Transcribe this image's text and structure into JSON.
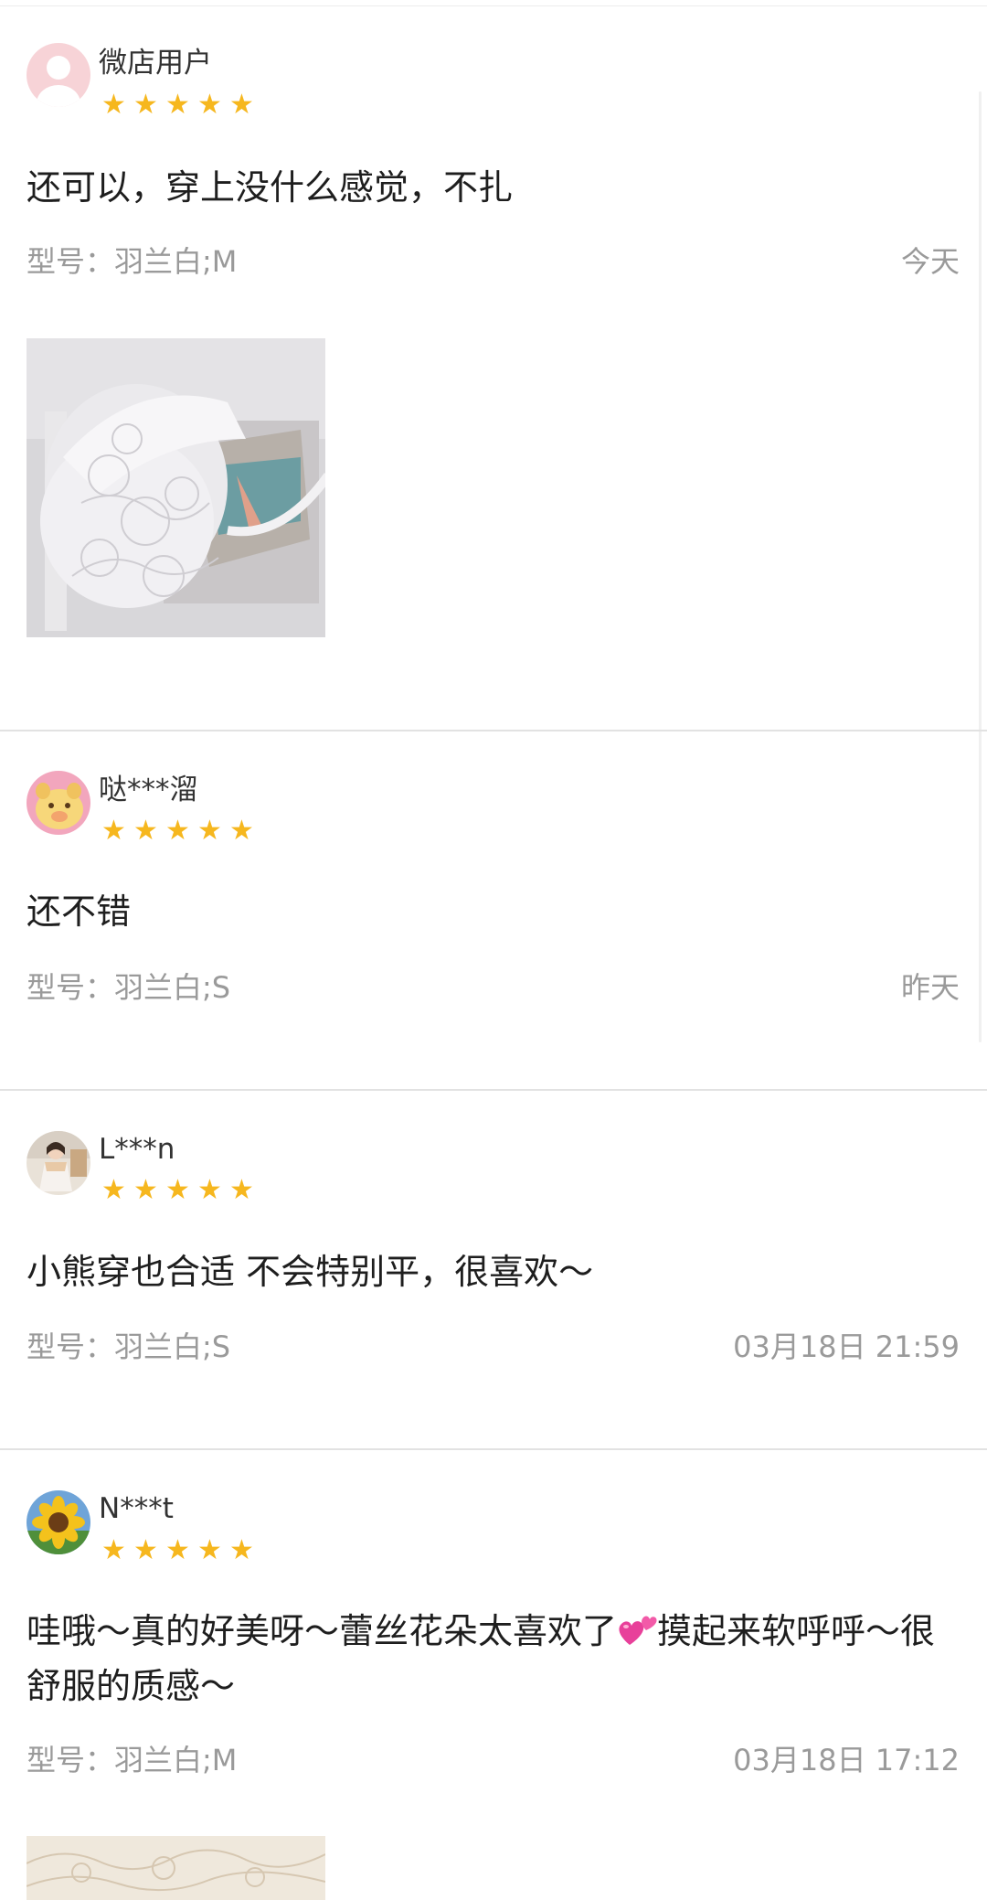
{
  "reviews": [
    {
      "username": "微店用户",
      "rating": 5,
      "content": "还可以，穿上没什么感觉，不扎",
      "model": "型号：羽兰白;M",
      "date": "今天",
      "avatar": "default-avatar",
      "has_photo": true
    },
    {
      "username": "哒***溜",
      "rating": 5,
      "content": "还不错",
      "model": "型号：羽兰白;S",
      "date": "昨天",
      "avatar": "cartoon-pig-avatar",
      "has_photo": false
    },
    {
      "username": "L***n",
      "rating": 5,
      "content": "小熊穿也合适 不会特别平，很喜欢～",
      "model": "型号：羽兰白;S",
      "date": "03月18日 21:59",
      "avatar": "girl-photo-avatar",
      "has_photo": false
    },
    {
      "username": "N***t",
      "rating": 5,
      "content_before_emoji": "哇哦～真的好美呀～蕾丝花朵太喜欢了",
      "content_emoji": "two-hearts-emoji",
      "content_after_emoji": "摸起来软呼呼～很舒服的质感～",
      "model": "型号：羽兰白;M",
      "date": "03月18日 17:12",
      "avatar": "sunflower-avatar",
      "has_photo": true
    }
  ],
  "star_glyph": "★",
  "colors": {
    "star": "#f6b71e",
    "text_primary": "#1e1e1e",
    "text_secondary": "#9a9a9a",
    "divider": "#e2e2e2"
  }
}
